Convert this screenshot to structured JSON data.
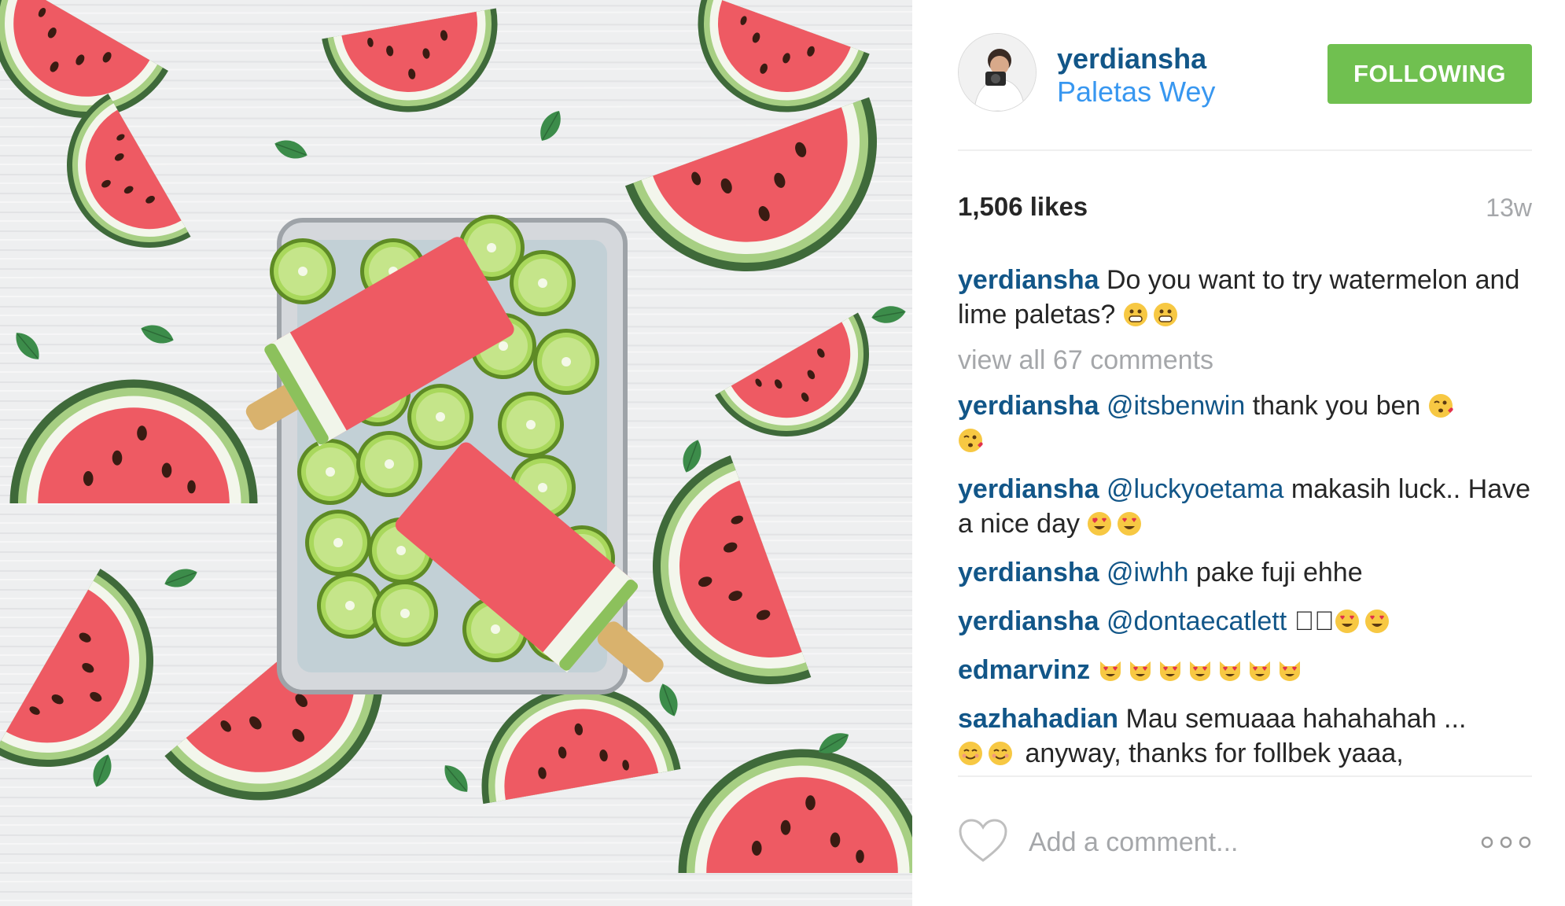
{
  "post": {
    "username": "yerdiansha",
    "location": "Paletas Wey",
    "follow_label": "FOLLOWING",
    "likes": "1,506 likes",
    "age": "13w",
    "caption": {
      "author": "yerdiansha",
      "text": "Do you want to try watermelon and lime paletas?",
      "emojis": [
        "grinning-face-emoji",
        "grinning-face-emoji"
      ]
    },
    "view_all": "view all 67 comments",
    "comments": [
      {
        "author": "yerdiansha",
        "mention": "@itsbenwin",
        "text": "thank you ben",
        "emojis": [
          "kissing-heart-emoji",
          "kissing-heart-emoji"
        ]
      },
      {
        "author": "yerdiansha",
        "mention": "@luckyoetama",
        "text": "makasih luck.. Have a nice day",
        "emojis": [
          "heart-eyes-emoji",
          "heart-eyes-emoji"
        ]
      },
      {
        "author": "yerdiansha",
        "mention": "@iwhh",
        "text": "pake fuji ehhe",
        "emojis": []
      },
      {
        "author": "yerdiansha",
        "mention": "@dontaecatlett",
        "text": "􏰀􏰀",
        "emojis": [
          "heart-eyes-emoji",
          "heart-eyes-emoji"
        ]
      },
      {
        "author": "edmarvinz",
        "mention": "",
        "text": "",
        "emojis": [
          "heart-eyes-cat-emoji",
          "heart-eyes-cat-emoji",
          "heart-eyes-cat-emoji",
          "heart-eyes-cat-emoji",
          "heart-eyes-cat-emoji",
          "heart-eyes-cat-emoji",
          "heart-eyes-cat-emoji"
        ]
      },
      {
        "author": "sazhahadian",
        "mention": "",
        "text": "Mau semuaaa hahahahah ...",
        "emojis": [
          "smiling-face-emoji",
          "smiling-face-emoji"
        ],
        "text_after": "anyway, thanks for follbek yaaa,"
      }
    ],
    "comment_placeholder": "Add a comment...",
    "colors": {
      "username": "#125688",
      "location": "#3897f0",
      "follow_button": "#70c050",
      "muted": "#a5a7aa"
    },
    "icons": {
      "like": "heart-outline-icon",
      "more": "ellipsis-icon"
    }
  }
}
